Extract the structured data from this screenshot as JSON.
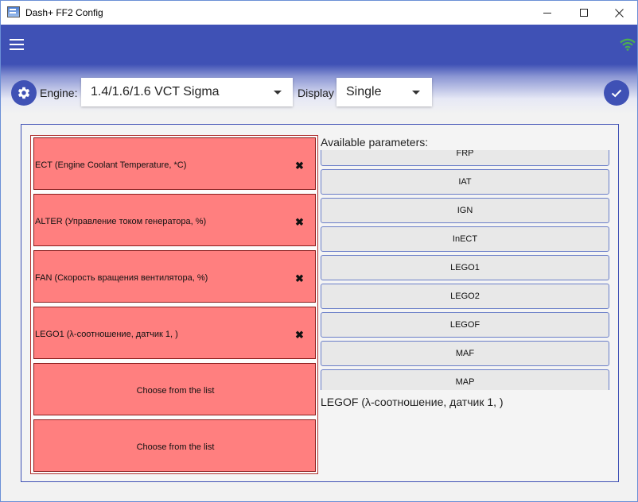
{
  "window": {
    "title": "Dash+ FF2 Config"
  },
  "toolbar": {
    "engine_label": "Engine:",
    "engine_value": "1.4/1.6/1.6 VCT Sigma",
    "display_label": "Display",
    "display_value": "Single"
  },
  "slots": [
    {
      "text": "ECT (Engine Coolant Temperature, *C)",
      "remove": "✖"
    },
    {
      "text": "ALTER (Управление током генератора, %)",
      "remove": "✖"
    },
    {
      "text": "FAN (Скорость вращения вентилятора, %)",
      "remove": "✖"
    },
    {
      "text": "LEGO1 (λ-соотношение, датчик 1, )",
      "remove": "✖"
    },
    {
      "text": "Choose from the list"
    },
    {
      "text": "Choose from the list"
    }
  ],
  "available": {
    "title": "Available parameters:",
    "items": [
      "FRP",
      "IAT",
      "IGN",
      "InECT",
      "LEGO1",
      "LEGO2",
      "LEGOF",
      "MAF",
      "MAP"
    ],
    "selected_description": "LEGOF (λ-соотношение, датчик 1, )"
  },
  "colors": {
    "accent": "#3f51b5",
    "slot_fill": "#ff7f7f",
    "wifi": "#4caf50"
  }
}
